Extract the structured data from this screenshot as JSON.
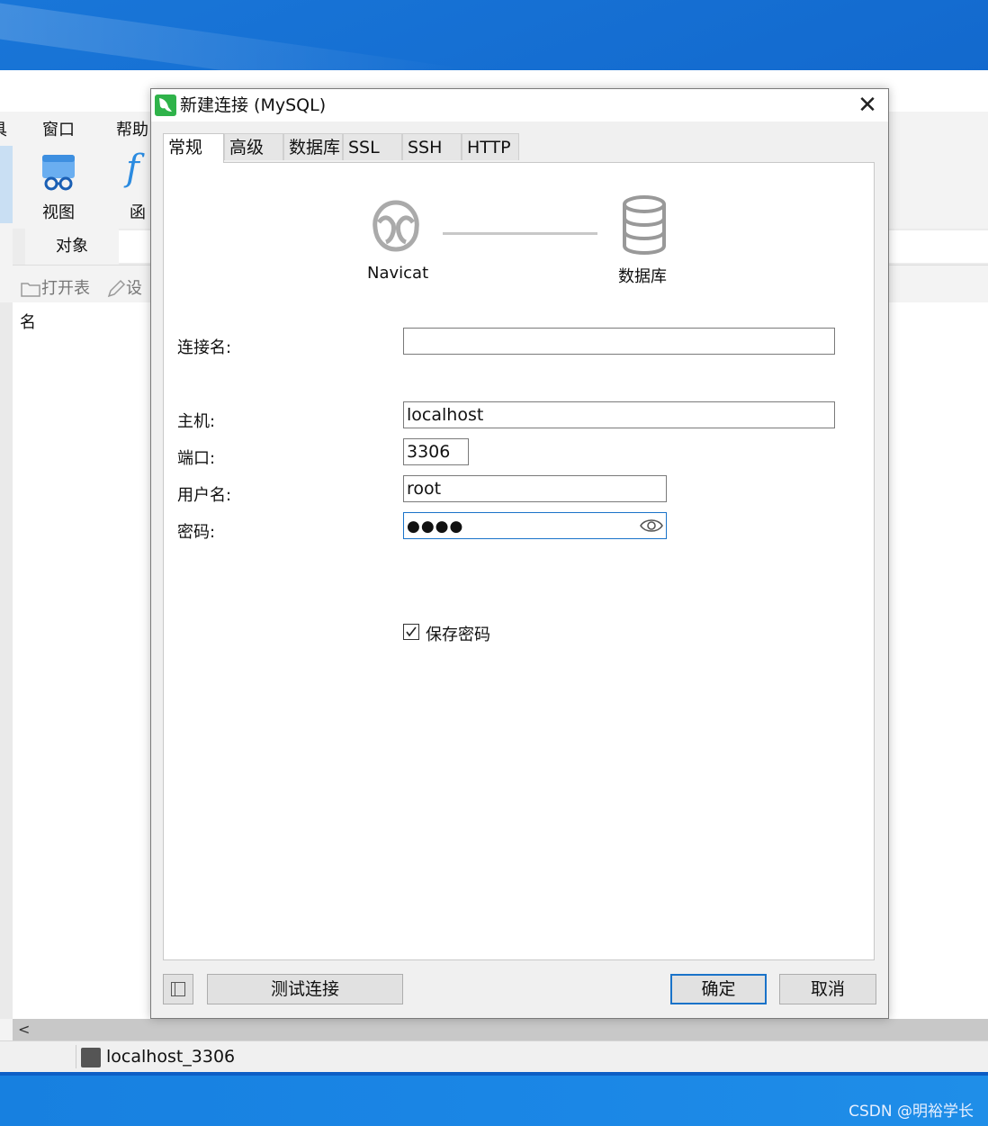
{
  "main_window": {
    "menu": [
      "具",
      "窗口",
      "帮助"
    ],
    "ribbon": [
      {
        "label": "视图",
        "icon": "view-icon"
      },
      {
        "label": "函",
        "icon": "function-icon"
      }
    ],
    "object_tab": "对象",
    "toolbar": [
      "打开表",
      "设"
    ],
    "list_header": "名",
    "status_connection": "localhost_3306"
  },
  "dialog": {
    "title": "新建连接 (MySQL)",
    "tabs": [
      "常规",
      "高级",
      "数据库",
      "SSL",
      "SSH",
      "HTTP"
    ],
    "active_tab": "常规",
    "diagram": {
      "left": "Navicat",
      "right": "数据库"
    },
    "fields": {
      "connection_name": {
        "label": "连接名:",
        "value": ""
      },
      "host": {
        "label": "主机:",
        "value": "localhost"
      },
      "port": {
        "label": "端口:",
        "value": "3306"
      },
      "username": {
        "label": "用户名:",
        "value": "root"
      },
      "password": {
        "label": "密码:",
        "value": "●●●●"
      }
    },
    "save_password": {
      "label": "保存密码",
      "checked": true
    },
    "buttons": {
      "test": "测试连接",
      "ok": "确定",
      "cancel": "取消"
    },
    "close_glyph": "✕"
  },
  "watermark": "CSDN @明裕学长",
  "colors": {
    "accent": "#1a73c9",
    "app_icon": "#2fb34a",
    "desktop": "#1677d4"
  }
}
